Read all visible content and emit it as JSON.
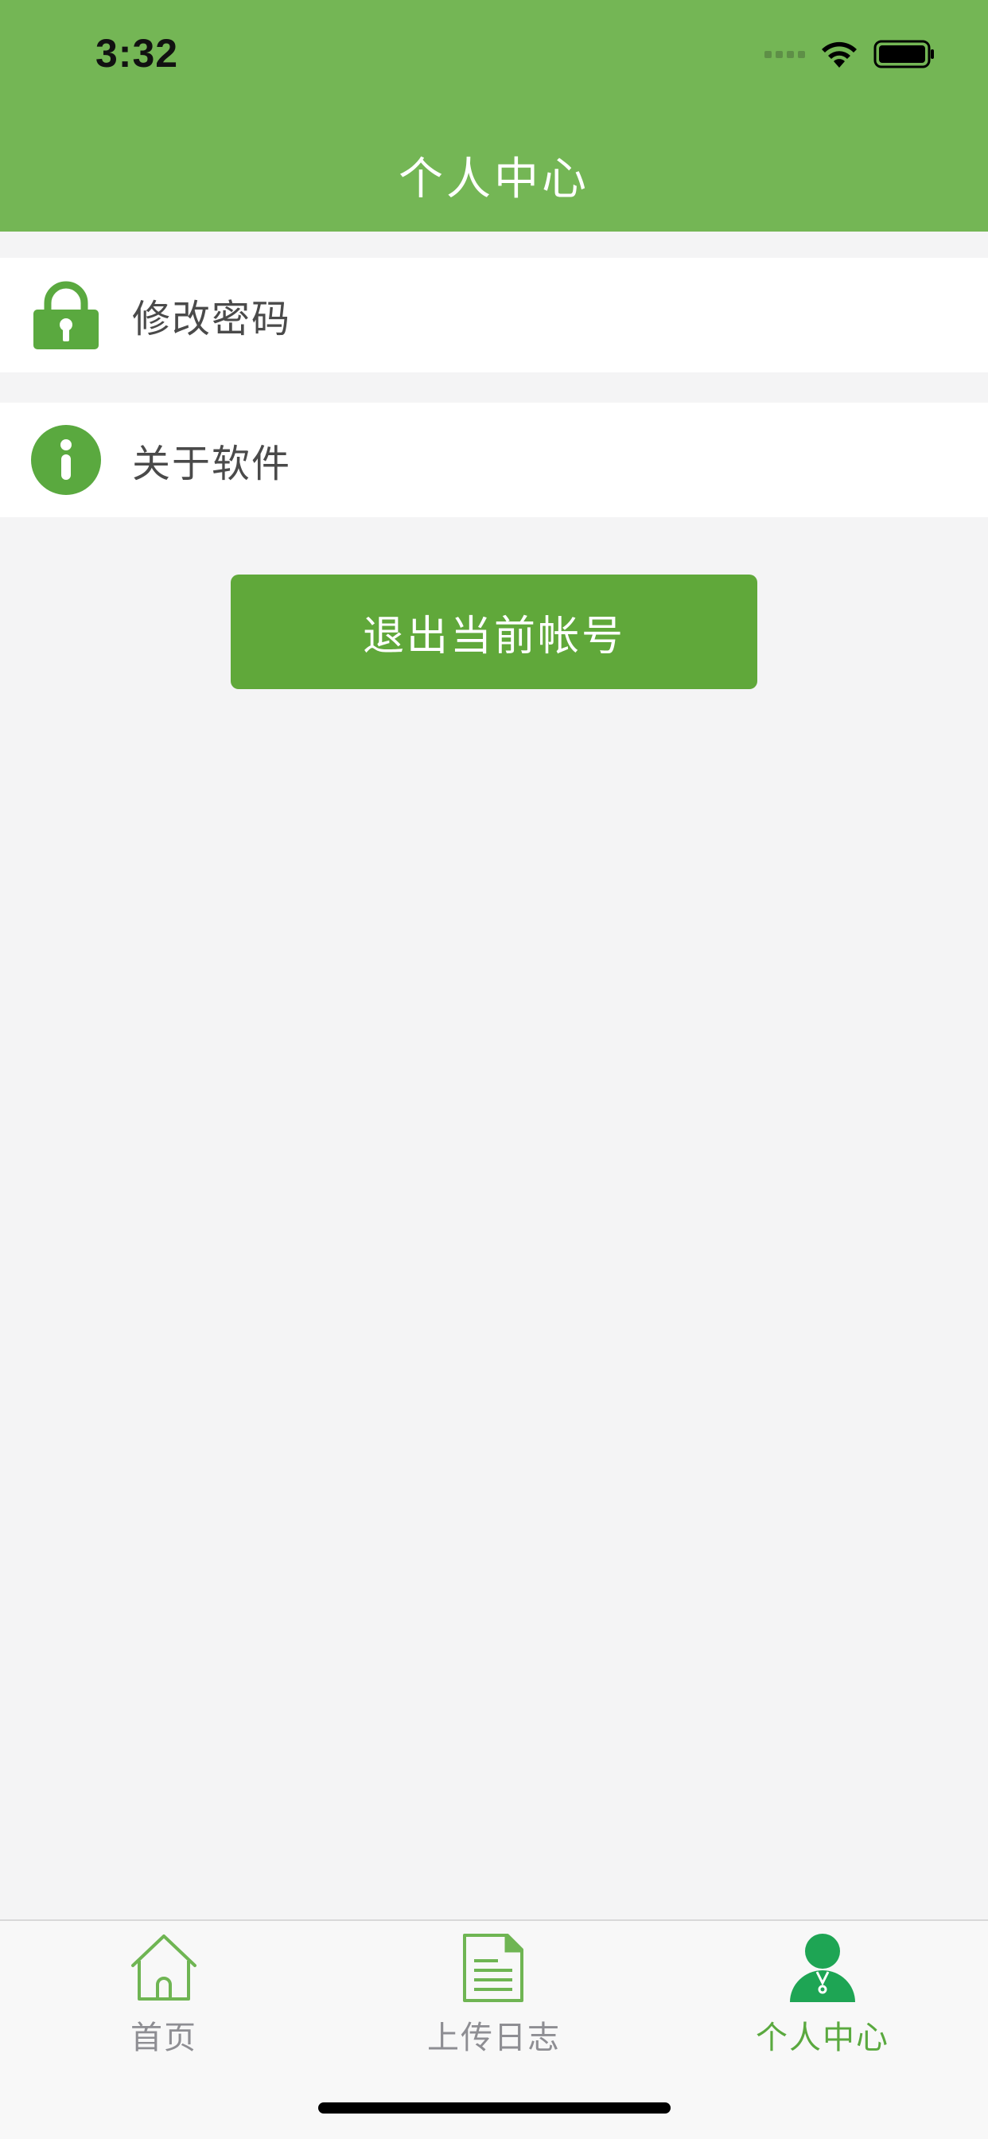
{
  "status_bar": {
    "time": "3:32"
  },
  "header": {
    "title": "个人中心",
    "background_color": "#74b655"
  },
  "menu": {
    "items": [
      {
        "label": "修改密码",
        "icon": "lock-icon"
      },
      {
        "label": "关于软件",
        "icon": "info-icon"
      }
    ]
  },
  "logout_button": {
    "label": "退出当前帐号",
    "color": "#60a83a"
  },
  "tabbar": {
    "tabs": [
      {
        "label": "首页",
        "icon": "home-icon",
        "active": false
      },
      {
        "label": "上传日志",
        "icon": "document-icon",
        "active": false
      },
      {
        "label": "个人中心",
        "icon": "user-icon",
        "active": true
      }
    ],
    "active_color": "#5aa93f",
    "inactive_color": "#8e8e93"
  }
}
